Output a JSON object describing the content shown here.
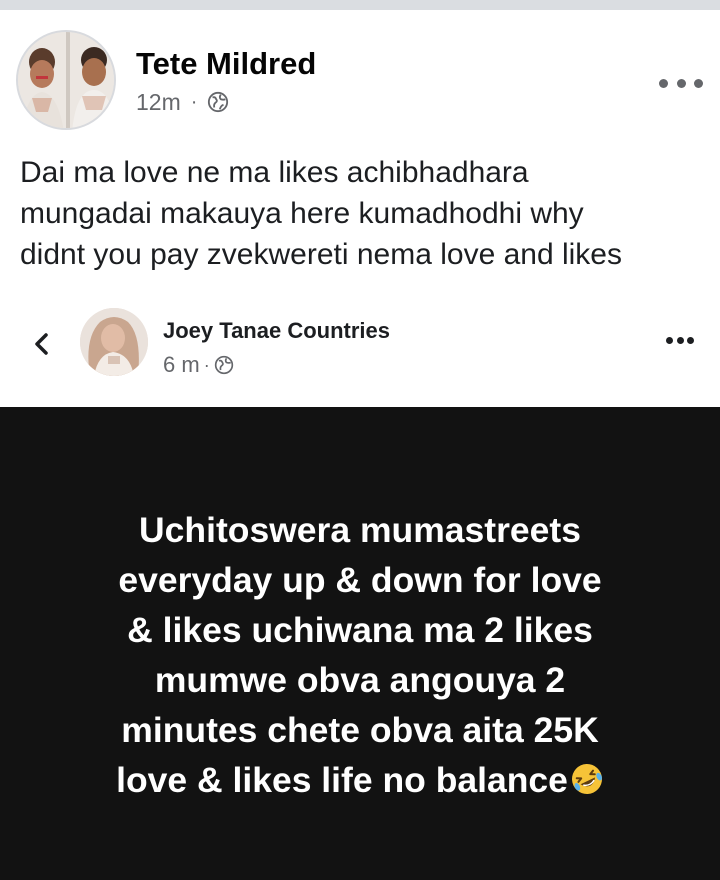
{
  "post": {
    "author": "Tete Mildred",
    "time": "12m",
    "separator": "·",
    "audience_icon": "globe-icon",
    "text_lines": [
      "Dai ma love ne ma likes achibhadhara",
      "mungadai makauya here kumadhodhi why",
      "didnt you pay zvekwereti nema love and likes"
    ]
  },
  "shared": {
    "author": "Joey Tanae Countries",
    "time": "6 m",
    "separator": "·",
    "audience_icon": "globe-icon",
    "status_lines": [
      "Uchitoswera mumastreets",
      "everyday up & down for love",
      "& likes uchiwana ma 2 likes",
      "mumwe obva angouya 2",
      "minutes chete obva aita 25K",
      "love & likes life no balance"
    ],
    "status_emoji": "rolling-on-floor-laughing-emoji"
  },
  "colors": {
    "status_background": "#121212",
    "status_text": "#ffffff",
    "meta_text": "#65676b",
    "name_text": "#050505"
  }
}
